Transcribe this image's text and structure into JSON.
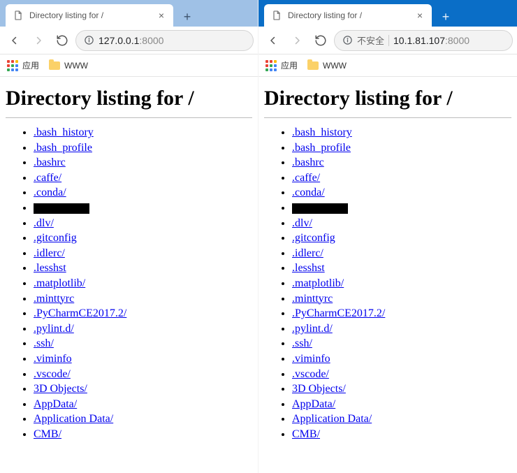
{
  "tab_title": "Directory listing for /",
  "bookmarks": {
    "apps_label": "应用",
    "folder_label": "WWW"
  },
  "page_heading": "Directory listing for /",
  "files": [
    ".bash_history",
    ".bash_profile",
    ".bashrc",
    ".caffe/",
    ".conda/",
    "__REDACTED__",
    ".dlv/",
    ".gitconfig",
    ".idlerc/",
    ".lesshst",
    ".matplotlib/",
    ".minttyrc",
    ".PyCharmCE2017.2/",
    ".pylint.d/",
    ".ssh/",
    ".viminfo",
    ".vscode/",
    "3D Objects/",
    "AppData/",
    "Application Data/",
    "CMB/"
  ],
  "windows": [
    {
      "theme": "light",
      "security_label": null,
      "url_host": "127.0.0.1",
      "url_port": ":8000"
    },
    {
      "theme": "dark",
      "security_label": "不安全",
      "url_host": "10.1.81.107",
      "url_port": ":8000"
    }
  ]
}
